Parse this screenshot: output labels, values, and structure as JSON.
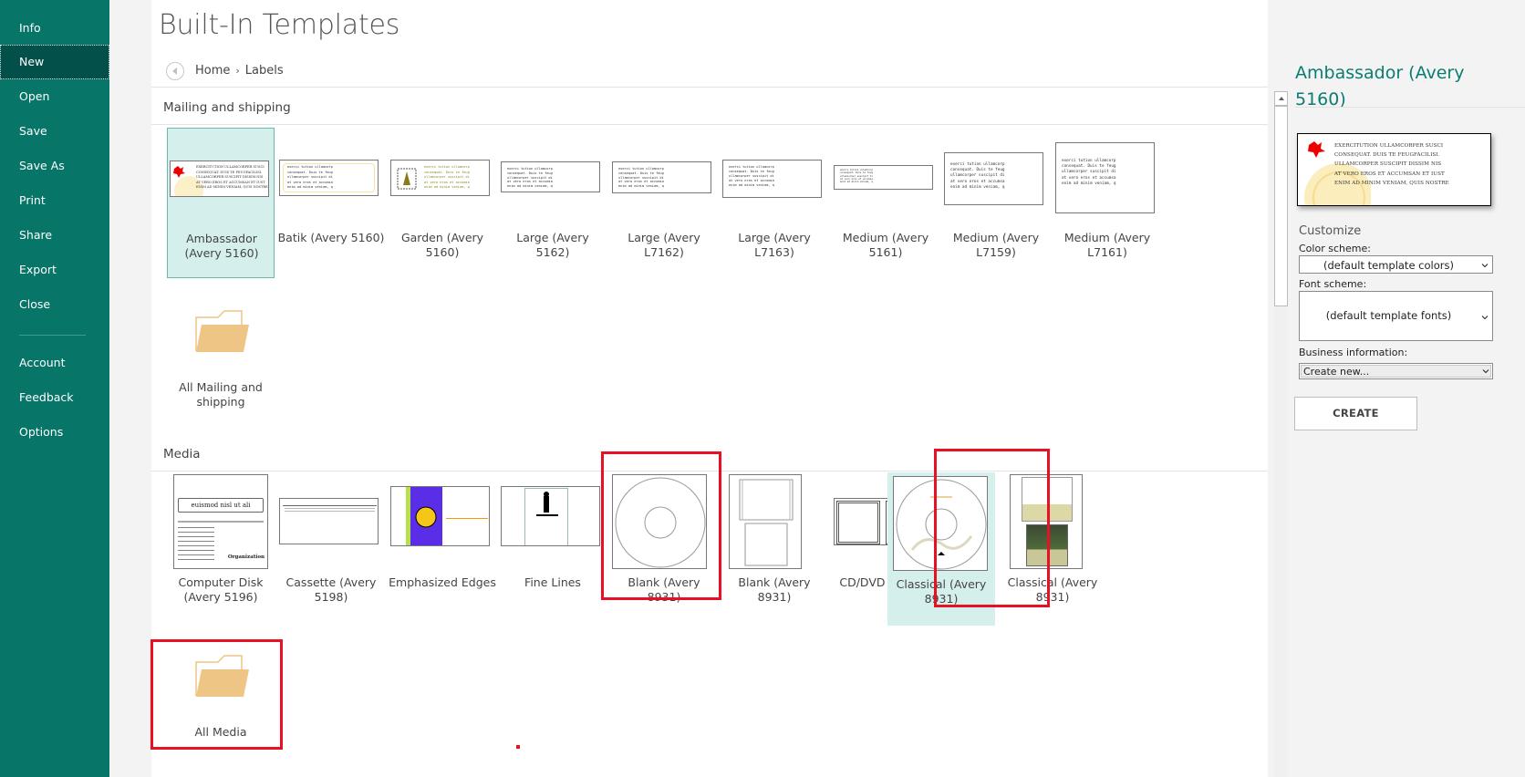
{
  "sidebar": {
    "items": [
      {
        "label": "Info",
        "icon": "none"
      },
      {
        "label": "New",
        "active": true
      },
      {
        "label": "Open"
      },
      {
        "label": "Save"
      },
      {
        "label": "Save As"
      },
      {
        "label": "Print"
      },
      {
        "label": "Share"
      },
      {
        "label": "Export"
      },
      {
        "label": "Close"
      },
      {
        "label": "Account"
      },
      {
        "label": "Feedback"
      },
      {
        "label": "Options"
      }
    ]
  },
  "header": {
    "title": "Built-In Templates",
    "back_icon": "back-arrow-icon",
    "breadcrumb": {
      "home": "Home",
      "separator": "›",
      "current": "Labels"
    }
  },
  "sections": {
    "mailing": {
      "title": "Mailing and shipping",
      "templates": [
        {
          "label": "Ambassador (Avery 5160)",
          "selected": true
        },
        {
          "label": "Batik (Avery 5160)"
        },
        {
          "label": "Garden (Avery 5160)"
        },
        {
          "label": "Large (Avery 5162)"
        },
        {
          "label": "Large (Avery L7162)"
        },
        {
          "label": "Large (Avery L7163)"
        },
        {
          "label": "Medium (Avery 5161)"
        },
        {
          "label": "Medium (Avery L7159)"
        },
        {
          "label": "Medium (Avery L7161)"
        }
      ],
      "folder": {
        "label": "All Mailing and shipping",
        "icon": "folder-icon"
      }
    },
    "media": {
      "title": "Media",
      "templates": [
        {
          "label": "Computer Disk (Avery 5196)"
        },
        {
          "label": "Cassette (Avery 5198)"
        },
        {
          "label": "Emphasized Edges"
        },
        {
          "label": "Fine Lines"
        },
        {
          "label": "Blank (Avery 8931)",
          "highlighted": true
        },
        {
          "label": "Blank (Avery 8931)"
        },
        {
          "label": "CD/DVD Booklet"
        },
        {
          "label": "Classical (Avery 8931)",
          "selected": true,
          "highlighted": true
        },
        {
          "label": "Classical (Avery 8931)"
        }
      ],
      "folder": {
        "label": "All Media",
        "icon": "folder-icon",
        "highlighted": true
      }
    }
  },
  "thumb_text": {
    "lorem": "exerci tution ullamcorp\nconsequat. Duis te feug\nullamcorper suscipit di\nat vero eros et accumsa\nenim ad minim veniam, q",
    "ambassador": "EXERCITUTION ULLAMCORPER SUSCI\nCONSEQUAT. DUIS TE FEUGFACILISI.\nULLAMCORPER SUSCIPIT DISSIM NIS\nAT VERO EROS ET ACCUMSAN ET IUST\nENIM AD MINIM VENIAM, QUIS NOSTRE",
    "computer_disk_title": "euismod nisl ut ali",
    "computer_disk_org": "Organization"
  },
  "details": {
    "title": "Ambassador (Avery 5160)",
    "preview_text": "EXERCITUTION ULLAMCORPER SUSCI\nCONSEQUAT. DUIS TE FEUGFACILISI.\nULLAMCORPER SUSCIPIT DISSIM NIS\nAT VERO EROS ET ACCUMSAN ET IUST\nENIM AD MINIM VENIAM, QUIS NOSTRE",
    "customize_label": "Customize",
    "color_scheme": {
      "label": "Color scheme:",
      "value": "(default template colors)"
    },
    "font_scheme": {
      "label": "Font scheme:",
      "value": "(default template fonts)"
    },
    "business_info": {
      "label": "Business information:",
      "value": "Create new..."
    },
    "create_label": "CREATE"
  },
  "colors": {
    "sidebar_bg": "#077568",
    "sidebar_active": "#03504a",
    "accent_title": "#0b7d70",
    "selected_tile": "#d5efec",
    "highlight_box": "#e81123",
    "folder": "#eec584"
  }
}
